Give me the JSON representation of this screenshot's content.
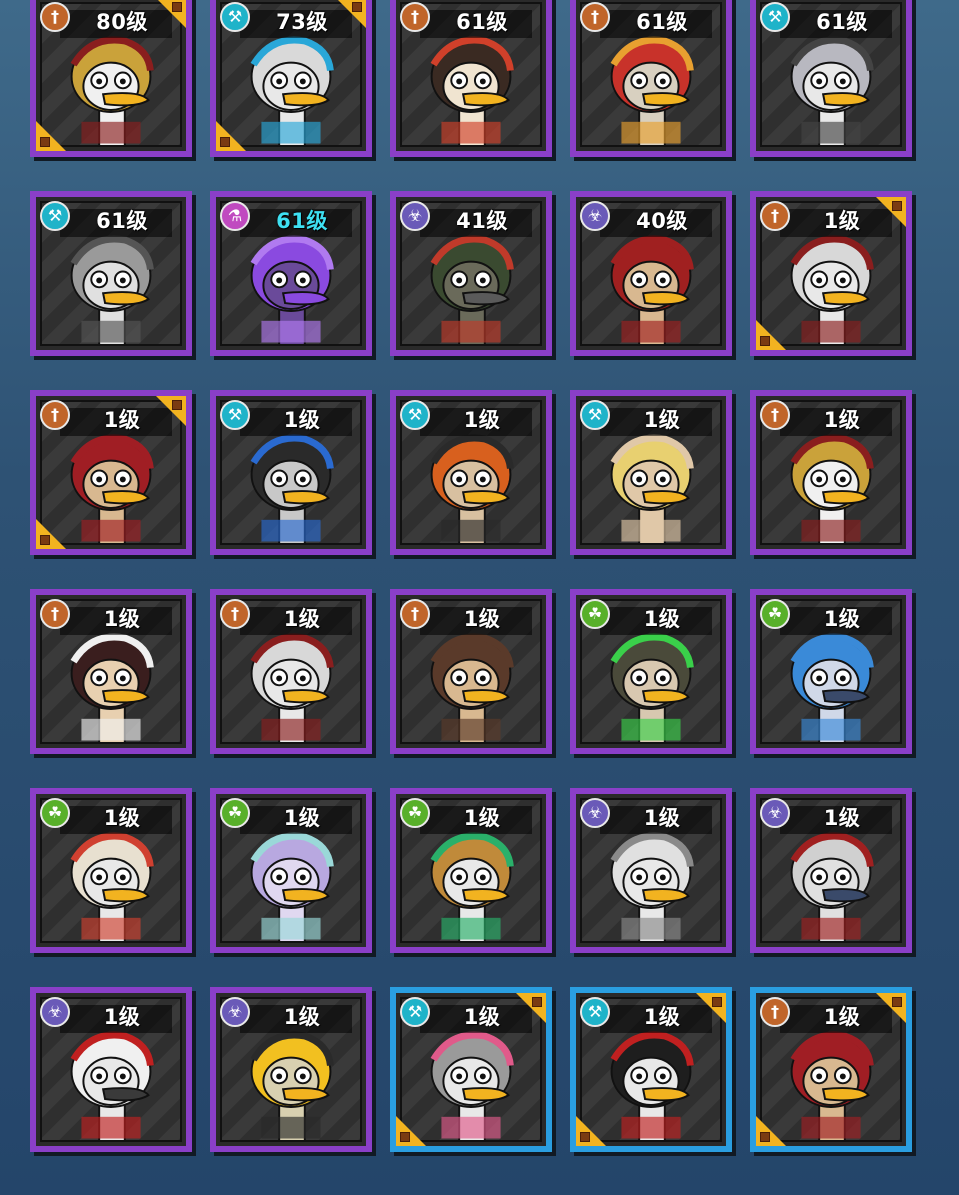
{
  "colors": {
    "frame_purple": "#8a3fc8",
    "frame_blue": "#2a9ee0",
    "corner_gold": "#f2b320",
    "class_weapon": "#c0652a",
    "class_tool": "#1fb3c9",
    "class_poison": "#6a5ab8",
    "class_magic": "#c04ac0",
    "class_nature": "#58b02a",
    "level_highlight": "#3ee0f2"
  },
  "cards": [
    {
      "level": "80级",
      "class_icon": "spear-icon",
      "class_color": "#c0652a",
      "frame": "purple",
      "gold_corners": true,
      "portrait": {
        "hair": "#caa23a",
        "skin": "#f0f0f0",
        "beak": "#f2b320",
        "accent": "#8a1e1e"
      }
    },
    {
      "level": "73级",
      "class_icon": "wrench-icon",
      "class_color": "#1fb3c9",
      "frame": "purple",
      "gold_corners": true,
      "portrait": {
        "hair": "#d9d9d9",
        "skin": "#e8e8e8",
        "beak": "#f2b320",
        "accent": "#29a7d8"
      }
    },
    {
      "level": "61级",
      "class_icon": "spear-icon",
      "class_color": "#c0652a",
      "frame": "purple",
      "gold_corners": false,
      "portrait": {
        "hair": "#3a2a22",
        "skin": "#f0e4d0",
        "beak": "#f2b320",
        "accent": "#d0402a"
      }
    },
    {
      "level": "61级",
      "class_icon": "spear-icon",
      "class_color": "#c0652a",
      "frame": "purple",
      "gold_corners": false,
      "portrait": {
        "hair": "#c8322a",
        "skin": "#d8d0c0",
        "beak": "#f2b320",
        "accent": "#e8a030"
      }
    },
    {
      "level": "61级",
      "class_icon": "wrench-icon",
      "class_color": "#1fb3c9",
      "frame": "purple",
      "gold_corners": false,
      "portrait": {
        "hair": "#b8b8c0",
        "skin": "#e8e8e8",
        "beak": "#f2b320",
        "accent": "#444444"
      }
    },
    {
      "level": "61级",
      "class_icon": "wrench-icon",
      "class_color": "#1fb3c9",
      "frame": "purple",
      "gold_corners": false,
      "portrait": {
        "hair": "#9a9a9a",
        "skin": "#e0e0e0",
        "beak": "#f2b320",
        "accent": "#555555"
      }
    },
    {
      "level": "61级",
      "level_highlight": true,
      "class_icon": "potion-icon",
      "class_color": "#c04ac0",
      "frame": "purple",
      "gold_corners": false,
      "portrait": {
        "hair": "#8a4ae0",
        "skin": "#6a4a9a",
        "beak": "#8a4ae0",
        "accent": "#b07af0"
      }
    },
    {
      "level": "41级",
      "class_icon": "biohazard-icon",
      "class_color": "#6a5ab8",
      "frame": "purple",
      "gold_corners": false,
      "portrait": {
        "hair": "#3a4a30",
        "skin": "#6a6a5a",
        "beak": "#5a5a5a",
        "accent": "#c03a2a"
      }
    },
    {
      "level": "40级",
      "class_icon": "biohazard-icon",
      "class_color": "#6a5ab8",
      "frame": "purple",
      "gold_corners": false,
      "portrait": {
        "hair": "#a02020",
        "skin": "#d8b890",
        "beak": "#f2b320",
        "accent": "#a02020"
      }
    },
    {
      "level": "1级",
      "class_icon": "spear-icon",
      "class_color": "#c0652a",
      "frame": "purple",
      "gold_corners": true,
      "portrait": {
        "hair": "#d8d8d8",
        "skin": "#e8e8e8",
        "beak": "#f2b320",
        "accent": "#8a1e1e"
      }
    },
    {
      "level": "1级",
      "class_icon": "spear-icon",
      "class_color": "#c0652a",
      "frame": "purple",
      "gold_corners": true,
      "portrait": {
        "hair": "#a01e24",
        "skin": "#d8b890",
        "beak": "#f2b320",
        "accent": "#a01e24"
      }
    },
    {
      "level": "1级",
      "class_icon": "wrench-icon",
      "class_color": "#1fb3c9",
      "frame": "purple",
      "gold_corners": false,
      "portrait": {
        "hair": "#2a2a2a",
        "skin": "#c8c8c8",
        "beak": "#f2b320",
        "accent": "#2a6ad0"
      }
    },
    {
      "level": "1级",
      "class_icon": "wrench-icon",
      "class_color": "#1fb3c9",
      "frame": "purple",
      "gold_corners": false,
      "portrait": {
        "hair": "#d8601e",
        "skin": "#d8c0a0",
        "beak": "#f2b320",
        "accent": "#2a2a2a"
      }
    },
    {
      "level": "1级",
      "class_icon": "wrench-icon",
      "class_color": "#1fb3c9",
      "frame": "purple",
      "gold_corners": false,
      "portrait": {
        "hair": "#e8d070",
        "skin": "#e0c8a8",
        "beak": "#f2b320",
        "accent": "#e0c8a8"
      }
    },
    {
      "level": "1级",
      "class_icon": "spear-icon",
      "class_color": "#c0652a",
      "frame": "purple",
      "gold_corners": false,
      "portrait": {
        "hair": "#caa23a",
        "skin": "#f0f0f0",
        "beak": "#f2b320",
        "accent": "#8a1e1e"
      }
    },
    {
      "level": "1级",
      "class_icon": "spear-icon",
      "class_color": "#c0652a",
      "frame": "purple",
      "gold_corners": false,
      "portrait": {
        "hair": "#3a1e1e",
        "skin": "#e8d0b0",
        "beak": "#f2b320",
        "accent": "#f0f0f0"
      }
    },
    {
      "level": "1级",
      "class_icon": "spear-icon",
      "class_color": "#c0652a",
      "frame": "purple",
      "gold_corners": false,
      "portrait": {
        "hair": "#d8d8d8",
        "skin": "#e8e8e8",
        "beak": "#f2b320",
        "accent": "#8a1e1e"
      }
    },
    {
      "level": "1级",
      "class_icon": "spear-icon",
      "class_color": "#c0652a",
      "frame": "purple",
      "gold_corners": false,
      "portrait": {
        "hair": "#5a3a2a",
        "skin": "#d8b890",
        "beak": "#f2b320",
        "accent": "#5a3a2a"
      }
    },
    {
      "level": "1级",
      "class_icon": "leaf-icon",
      "class_color": "#58b02a",
      "frame": "purple",
      "gold_corners": false,
      "portrait": {
        "hair": "#4a4a3a",
        "skin": "#d8c8b0",
        "beak": "#f2b320",
        "accent": "#3ad04a"
      }
    },
    {
      "level": "1级",
      "class_icon": "leaf-icon",
      "class_color": "#58b02a",
      "frame": "purple",
      "gold_corners": false,
      "portrait": {
        "hair": "#3a8ad8",
        "skin": "#d0d8e8",
        "beak": "#3a4a6a",
        "accent": "#3a8ad8"
      }
    },
    {
      "level": "1级",
      "class_icon": "leaf-icon",
      "class_color": "#58b02a",
      "frame": "purple",
      "gold_corners": false,
      "portrait": {
        "hair": "#e8e0d0",
        "skin": "#e8e8e8",
        "beak": "#f2b320",
        "accent": "#d04030"
      }
    },
    {
      "level": "1级",
      "class_icon": "leaf-icon",
      "class_color": "#58b02a",
      "frame": "purple",
      "gold_corners": false,
      "portrait": {
        "hair": "#b8a8e0",
        "skin": "#e0d8f0",
        "beak": "#f2b320",
        "accent": "#9ad8d8"
      }
    },
    {
      "level": "1级",
      "class_icon": "leaf-icon",
      "class_color": "#58b02a",
      "frame": "purple",
      "gold_corners": false,
      "portrait": {
        "hair": "#c08a3a",
        "skin": "#e8e8e8",
        "beak": "#f2b320",
        "accent": "#2ab06a"
      }
    },
    {
      "level": "1级",
      "class_icon": "biohazard-icon",
      "class_color": "#6a5ab8",
      "frame": "purple",
      "gold_corners": false,
      "portrait": {
        "hair": "#e0e0e0",
        "skin": "#e8e8e8",
        "beak": "#f2b320",
        "accent": "#8a8a8a"
      }
    },
    {
      "level": "1级",
      "class_icon": "biohazard-icon",
      "class_color": "#6a5ab8",
      "frame": "purple",
      "gold_corners": false,
      "portrait": {
        "hair": "#d0d0d0",
        "skin": "#e0e0e0",
        "beak": "#3a4a6a",
        "accent": "#a02020"
      }
    },
    {
      "level": "1级",
      "class_icon": "biohazard-icon",
      "class_color": "#6a5ab8",
      "frame": "purple",
      "gold_corners": false,
      "portrait": {
        "hair": "#f0f0f0",
        "skin": "#e8e8e8",
        "beak": "#3a3a3a",
        "accent": "#c02020"
      }
    },
    {
      "level": "1级",
      "class_icon": "biohazard-icon",
      "class_color": "#6a5ab8",
      "frame": "purple",
      "gold_corners": false,
      "portrait": {
        "hair": "#f2c020",
        "skin": "#d8d0b0",
        "beak": "#f2b320",
        "accent": "#2a2a2a"
      }
    },
    {
      "level": "1级",
      "class_icon": "wrench-icon",
      "class_color": "#1fb3c9",
      "frame": "blue",
      "gold_corners": true,
      "portrait": {
        "hair": "#9a9a9a",
        "skin": "#e8e8e8",
        "beak": "#f2b320",
        "accent": "#e05a8a"
      }
    },
    {
      "level": "1级",
      "class_icon": "wrench-icon",
      "class_color": "#1fb3c9",
      "frame": "blue",
      "gold_corners": true,
      "portrait": {
        "hair": "#1e1e1e",
        "skin": "#e8e8e8",
        "beak": "#f2b320",
        "accent": "#c02020"
      }
    },
    {
      "level": "1级",
      "class_icon": "spear-icon",
      "class_color": "#c0652a",
      "frame": "blue",
      "gold_corners": true,
      "portrait": {
        "hair": "#a01e24",
        "skin": "#d8b890",
        "beak": "#f2b320",
        "accent": "#a01e24"
      }
    }
  ]
}
